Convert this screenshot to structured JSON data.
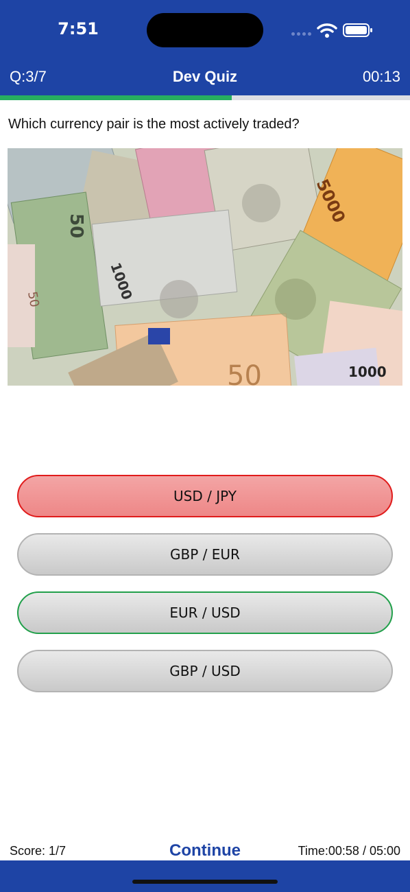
{
  "status_bar": {
    "time": "7:51"
  },
  "nav": {
    "question_counter": "Q:3/7",
    "title": "Dev Quiz",
    "countdown": "00:13"
  },
  "progress": {
    "fraction": 0.566,
    "fill_color": "#27ae60"
  },
  "question": {
    "text": "Which currency pair is the most actively traded?"
  },
  "image": {
    "banknote_labels": [
      "50",
      "5000",
      "1000",
      "50",
      "50",
      "1000"
    ]
  },
  "answers": [
    {
      "label": "USD / JPY",
      "state": "wrong"
    },
    {
      "label": "GBP / EUR",
      "state": "neutral"
    },
    {
      "label": "EUR / USD",
      "state": "correct"
    },
    {
      "label": "GBP / USD",
      "state": "neutral"
    }
  ],
  "footer": {
    "score": "Score: 1/7",
    "continue_label": "Continue",
    "timer": "Time:00:58 / 05:00"
  },
  "colors": {
    "brand": "#1e44a5",
    "wrong_border": "#e01b1b",
    "correct_border": "#22a04b"
  }
}
